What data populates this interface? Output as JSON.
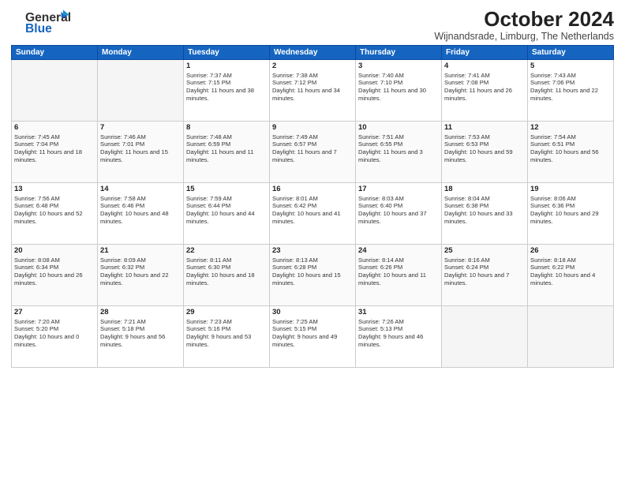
{
  "logo": {
    "line1": "General",
    "line2": "Blue"
  },
  "header": {
    "title": "October 2024",
    "subtitle": "Wijnandsrade, Limburg, The Netherlands"
  },
  "weekdays": [
    "Sunday",
    "Monday",
    "Tuesday",
    "Wednesday",
    "Thursday",
    "Friday",
    "Saturday"
  ],
  "weeks": [
    [
      {
        "day": "",
        "text": ""
      },
      {
        "day": "",
        "text": ""
      },
      {
        "day": "1",
        "text": "Sunrise: 7:37 AM\nSunset: 7:15 PM\nDaylight: 11 hours and 38 minutes."
      },
      {
        "day": "2",
        "text": "Sunrise: 7:38 AM\nSunset: 7:12 PM\nDaylight: 11 hours and 34 minutes."
      },
      {
        "day": "3",
        "text": "Sunrise: 7:40 AM\nSunset: 7:10 PM\nDaylight: 11 hours and 30 minutes."
      },
      {
        "day": "4",
        "text": "Sunrise: 7:41 AM\nSunset: 7:08 PM\nDaylight: 11 hours and 26 minutes."
      },
      {
        "day": "5",
        "text": "Sunrise: 7:43 AM\nSunset: 7:06 PM\nDaylight: 11 hours and 22 minutes."
      }
    ],
    [
      {
        "day": "6",
        "text": "Sunrise: 7:45 AM\nSunset: 7:04 PM\nDaylight: 11 hours and 18 minutes."
      },
      {
        "day": "7",
        "text": "Sunrise: 7:46 AM\nSunset: 7:01 PM\nDaylight: 11 hours and 15 minutes."
      },
      {
        "day": "8",
        "text": "Sunrise: 7:48 AM\nSunset: 6:59 PM\nDaylight: 11 hours and 11 minutes."
      },
      {
        "day": "9",
        "text": "Sunrise: 7:49 AM\nSunset: 6:57 PM\nDaylight: 11 hours and 7 minutes."
      },
      {
        "day": "10",
        "text": "Sunrise: 7:51 AM\nSunset: 6:55 PM\nDaylight: 11 hours and 3 minutes."
      },
      {
        "day": "11",
        "text": "Sunrise: 7:53 AM\nSunset: 6:53 PM\nDaylight: 10 hours and 59 minutes."
      },
      {
        "day": "12",
        "text": "Sunrise: 7:54 AM\nSunset: 6:51 PM\nDaylight: 10 hours and 56 minutes."
      }
    ],
    [
      {
        "day": "13",
        "text": "Sunrise: 7:56 AM\nSunset: 6:48 PM\nDaylight: 10 hours and 52 minutes."
      },
      {
        "day": "14",
        "text": "Sunrise: 7:58 AM\nSunset: 6:46 PM\nDaylight: 10 hours and 48 minutes."
      },
      {
        "day": "15",
        "text": "Sunrise: 7:59 AM\nSunset: 6:44 PM\nDaylight: 10 hours and 44 minutes."
      },
      {
        "day": "16",
        "text": "Sunrise: 8:01 AM\nSunset: 6:42 PM\nDaylight: 10 hours and 41 minutes."
      },
      {
        "day": "17",
        "text": "Sunrise: 8:03 AM\nSunset: 6:40 PM\nDaylight: 10 hours and 37 minutes."
      },
      {
        "day": "18",
        "text": "Sunrise: 8:04 AM\nSunset: 6:38 PM\nDaylight: 10 hours and 33 minutes."
      },
      {
        "day": "19",
        "text": "Sunrise: 8:06 AM\nSunset: 6:36 PM\nDaylight: 10 hours and 29 minutes."
      }
    ],
    [
      {
        "day": "20",
        "text": "Sunrise: 8:08 AM\nSunset: 6:34 PM\nDaylight: 10 hours and 26 minutes."
      },
      {
        "day": "21",
        "text": "Sunrise: 8:09 AM\nSunset: 6:32 PM\nDaylight: 10 hours and 22 minutes."
      },
      {
        "day": "22",
        "text": "Sunrise: 8:11 AM\nSunset: 6:30 PM\nDaylight: 10 hours and 18 minutes."
      },
      {
        "day": "23",
        "text": "Sunrise: 8:13 AM\nSunset: 6:28 PM\nDaylight: 10 hours and 15 minutes."
      },
      {
        "day": "24",
        "text": "Sunrise: 8:14 AM\nSunset: 6:26 PM\nDaylight: 10 hours and 11 minutes."
      },
      {
        "day": "25",
        "text": "Sunrise: 8:16 AM\nSunset: 6:24 PM\nDaylight: 10 hours and 7 minutes."
      },
      {
        "day": "26",
        "text": "Sunrise: 8:18 AM\nSunset: 6:22 PM\nDaylight: 10 hours and 4 minutes."
      }
    ],
    [
      {
        "day": "27",
        "text": "Sunrise: 7:20 AM\nSunset: 5:20 PM\nDaylight: 10 hours and 0 minutes."
      },
      {
        "day": "28",
        "text": "Sunrise: 7:21 AM\nSunset: 5:18 PM\nDaylight: 9 hours and 56 minutes."
      },
      {
        "day": "29",
        "text": "Sunrise: 7:23 AM\nSunset: 5:16 PM\nDaylight: 9 hours and 53 minutes."
      },
      {
        "day": "30",
        "text": "Sunrise: 7:25 AM\nSunset: 5:15 PM\nDaylight: 9 hours and 49 minutes."
      },
      {
        "day": "31",
        "text": "Sunrise: 7:26 AM\nSunset: 5:13 PM\nDaylight: 9 hours and 46 minutes."
      },
      {
        "day": "",
        "text": ""
      },
      {
        "day": "",
        "text": ""
      }
    ]
  ]
}
